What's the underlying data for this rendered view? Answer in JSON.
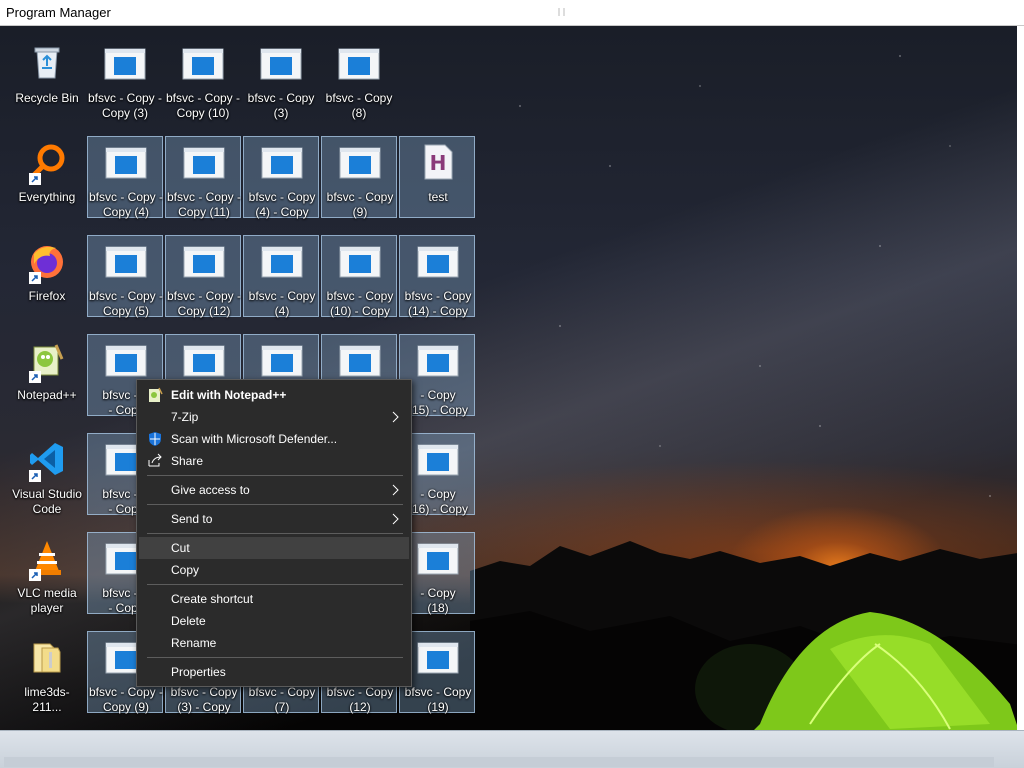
{
  "window": {
    "title": "Program Manager"
  },
  "desktop_left_icons": [
    {
      "label": "Recycle Bin",
      "icon": "recycle-bin-icon"
    },
    {
      "label": "Everything",
      "icon": "everything-search-icon"
    },
    {
      "label": "Firefox",
      "icon": "firefox-icon"
    },
    {
      "label": "Notepad++",
      "icon": "notepadpp-icon"
    },
    {
      "label": "Visual Studio Code",
      "icon": "vscode-icon"
    },
    {
      "label": "VLC media player",
      "icon": "vlc-icon"
    },
    {
      "label": "lime3ds-211...",
      "icon": "folder-zip-icon"
    }
  ],
  "desktop_grid": [
    [
      "bfsvc - Copy - Copy (3)",
      "bfsvc - Copy - Copy (10)",
      "bfsvc - Copy (3)",
      "bfsvc - Copy (8)"
    ],
    [
      "bfsvc - Copy - Copy (4)",
      "bfsvc - Copy - Copy (11)",
      "bfsvc - Copy (4) - Copy",
      "bfsvc - Copy (9)",
      "test"
    ],
    [
      "bfsvc - Copy - Copy (5)",
      "bfsvc - Copy - Copy (12)",
      "bfsvc - Copy (4)",
      "bfsvc - Copy (10) - Copy",
      "bfsvc - Copy (14) - Copy"
    ],
    [
      "bfsvc - C... - Copy",
      "",
      "",
      "",
      "...Copy (15) - Copy"
    ],
    [
      "bfsvc - C... - Copy",
      "",
      "",
      "",
      "...Copy (16) - Copy"
    ],
    [
      "bfsvc - C... - Copy",
      "",
      "",
      "",
      "bfsvc - Copy (18)"
    ],
    [
      "bfsvc - Copy - Copy (9)",
      "bfsvc - Copy (3) - Copy",
      "bfsvc - Copy (7)",
      "bfsvc - Copy (12)",
      "bfsvc - Copy (19)"
    ]
  ],
  "visible_labels": {
    "r3c0": "bfsvc - C",
    "r3c0b": "- Copy",
    "r3c4": "- Copy",
    "r3c4b": "(15) - Copy",
    "r4c0": "bfsvc - C",
    "r4c0b": "- Copy",
    "r4c4": "- Copy",
    "r4c4b": "(16) - Copy",
    "r5c0": "bfsvc - C",
    "r5c0b": "- Copy",
    "r5c4": "- Copy",
    "r5c4b": "(18)"
  },
  "context_menu": {
    "items": [
      {
        "label": "Edit with Notepad++",
        "icon": "notepadpp-icon",
        "bold": true
      },
      {
        "label": "7-Zip",
        "submenu": true
      },
      {
        "label": "Scan with Microsoft Defender...",
        "icon": "defender-shield-icon"
      },
      {
        "label": "Share",
        "icon": "share-icon"
      },
      {
        "label": "Give access to",
        "submenu": true
      },
      {
        "label": "Send to",
        "submenu": true
      },
      {
        "label": "Cut",
        "highlighted": true
      },
      {
        "label": "Copy"
      },
      {
        "label": "Create shortcut"
      },
      {
        "label": "Delete"
      },
      {
        "label": "Rename"
      },
      {
        "label": "Properties"
      }
    ]
  },
  "colors": {
    "menu_bg": "#2b2b2b",
    "menu_highlight": "#414141",
    "selection": "#82a5c8",
    "accent_blue": "#1b7fd8"
  }
}
